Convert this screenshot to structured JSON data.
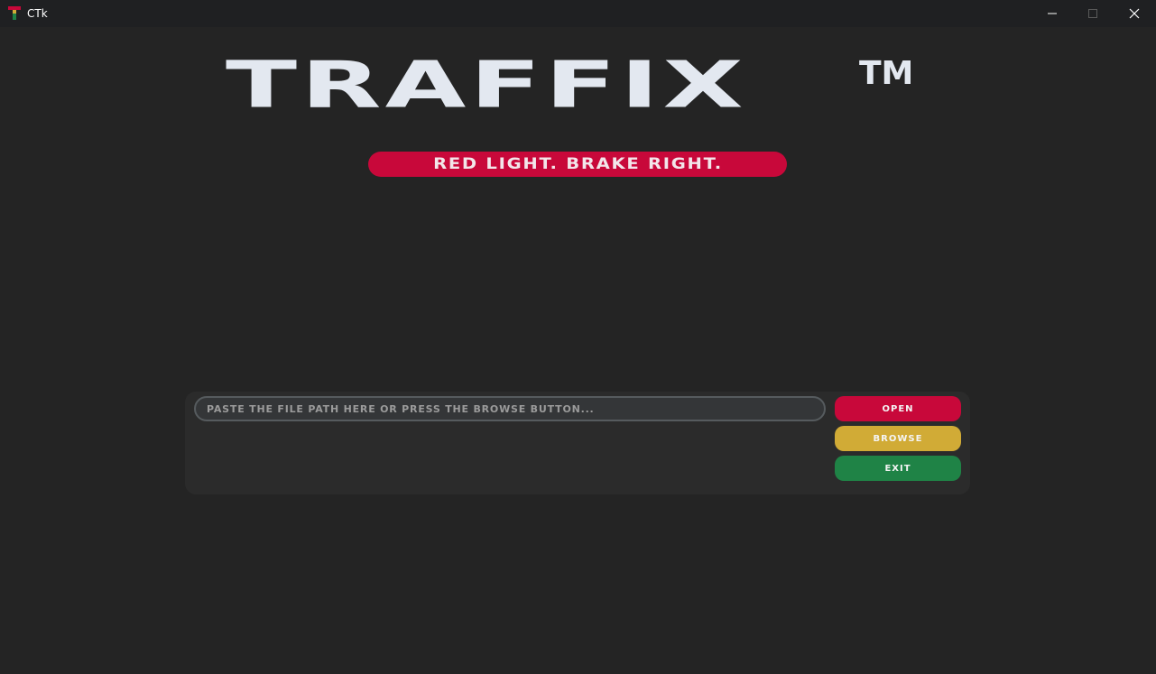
{
  "window": {
    "title": "CTk",
    "controls": [
      "minimize-icon",
      "maximize-icon",
      "close-icon"
    ]
  },
  "logo": {
    "text": "TRAFFIX",
    "trademark": "TM"
  },
  "tagline": {
    "text": "RED LIGHT. BRAKE RIGHT."
  },
  "file_panel": {
    "path_input_value": "",
    "path_input_placeholder": "PASTE THE FILE PATH HERE OR PRESS THE BROWSE BUTTON...",
    "open_label": "OPEN",
    "browse_label": "BROWSE",
    "exit_label": "EXIT"
  },
  "colors": {
    "background": "#242424",
    "titlebar": "#1f2022",
    "logo": "#e3e8f0",
    "red": "#c8083a",
    "yellow": "#d1ab36",
    "green": "#1f8346",
    "panel": "#2b2b2b"
  }
}
